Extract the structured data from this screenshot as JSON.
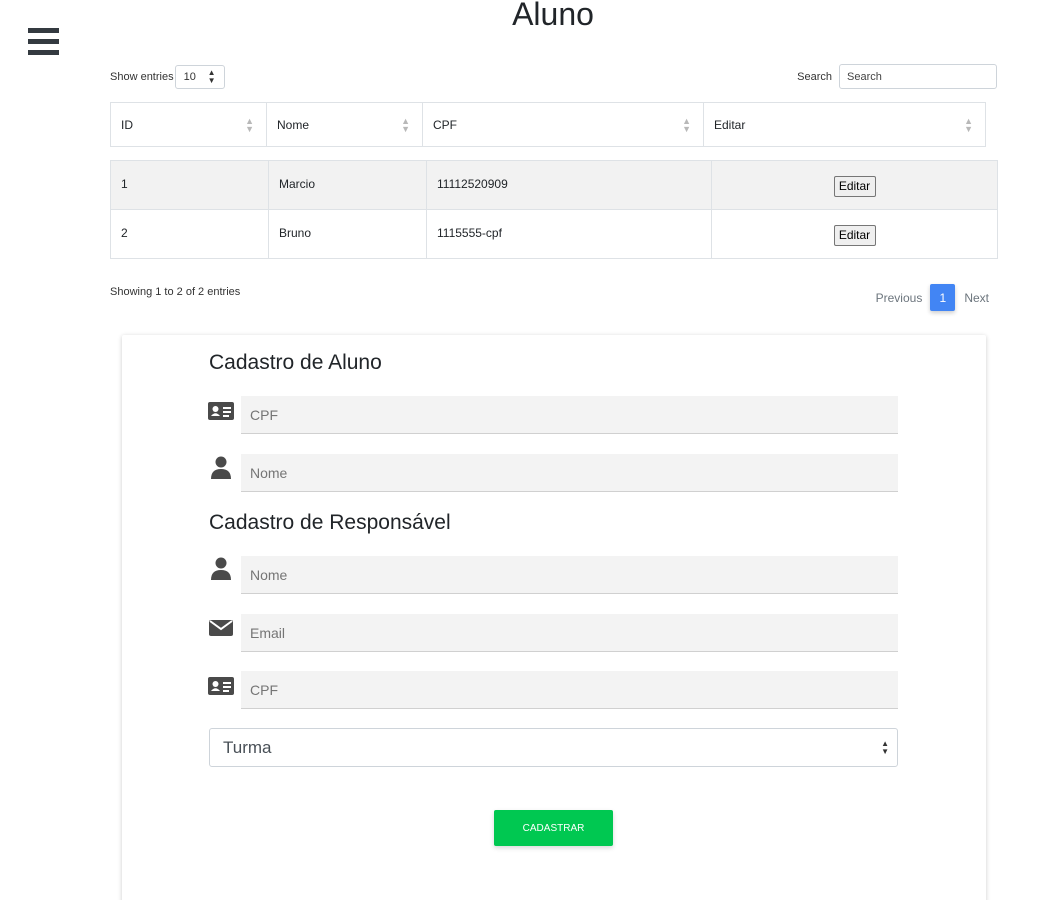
{
  "page": {
    "title": "Aluno"
  },
  "menu": {
    "icon": "hamburger-menu-icon"
  },
  "table_controls": {
    "show_entries_label": "Show entries",
    "entries_value": "10",
    "search_label": "Search",
    "search_placeholder": "Search"
  },
  "table": {
    "columns": [
      "ID",
      "Nome",
      "CPF",
      "Editar"
    ],
    "rows": [
      {
        "id": "1",
        "nome": "Marcio",
        "cpf": "11112520909",
        "action": "Editar"
      },
      {
        "id": "2",
        "nome": "Bruno",
        "cpf": "1115555-cpf",
        "action": "Editar"
      }
    ]
  },
  "table_footer": {
    "info": "Showing 1 to 2 of 2 entries",
    "previous": "Previous",
    "current_page": "1",
    "next": "Next"
  },
  "form": {
    "aluno_title": "Cadastro de Aluno",
    "aluno_cpf_placeholder": "CPF",
    "aluno_nome_placeholder": "Nome",
    "responsavel_title": "Cadastro de Responsável",
    "resp_nome_placeholder": "Nome",
    "resp_email_placeholder": "Email",
    "resp_cpf_placeholder": "CPF",
    "turma_value": "Turma",
    "submit_label": "CADASTRAR"
  },
  "colors": {
    "accent": "#4285f4",
    "submit": "#00c851",
    "icon": "#4a4a4a"
  },
  "icons": {
    "id_card": "id-card-icon",
    "user": "user-icon",
    "envelope": "envelope-icon"
  }
}
